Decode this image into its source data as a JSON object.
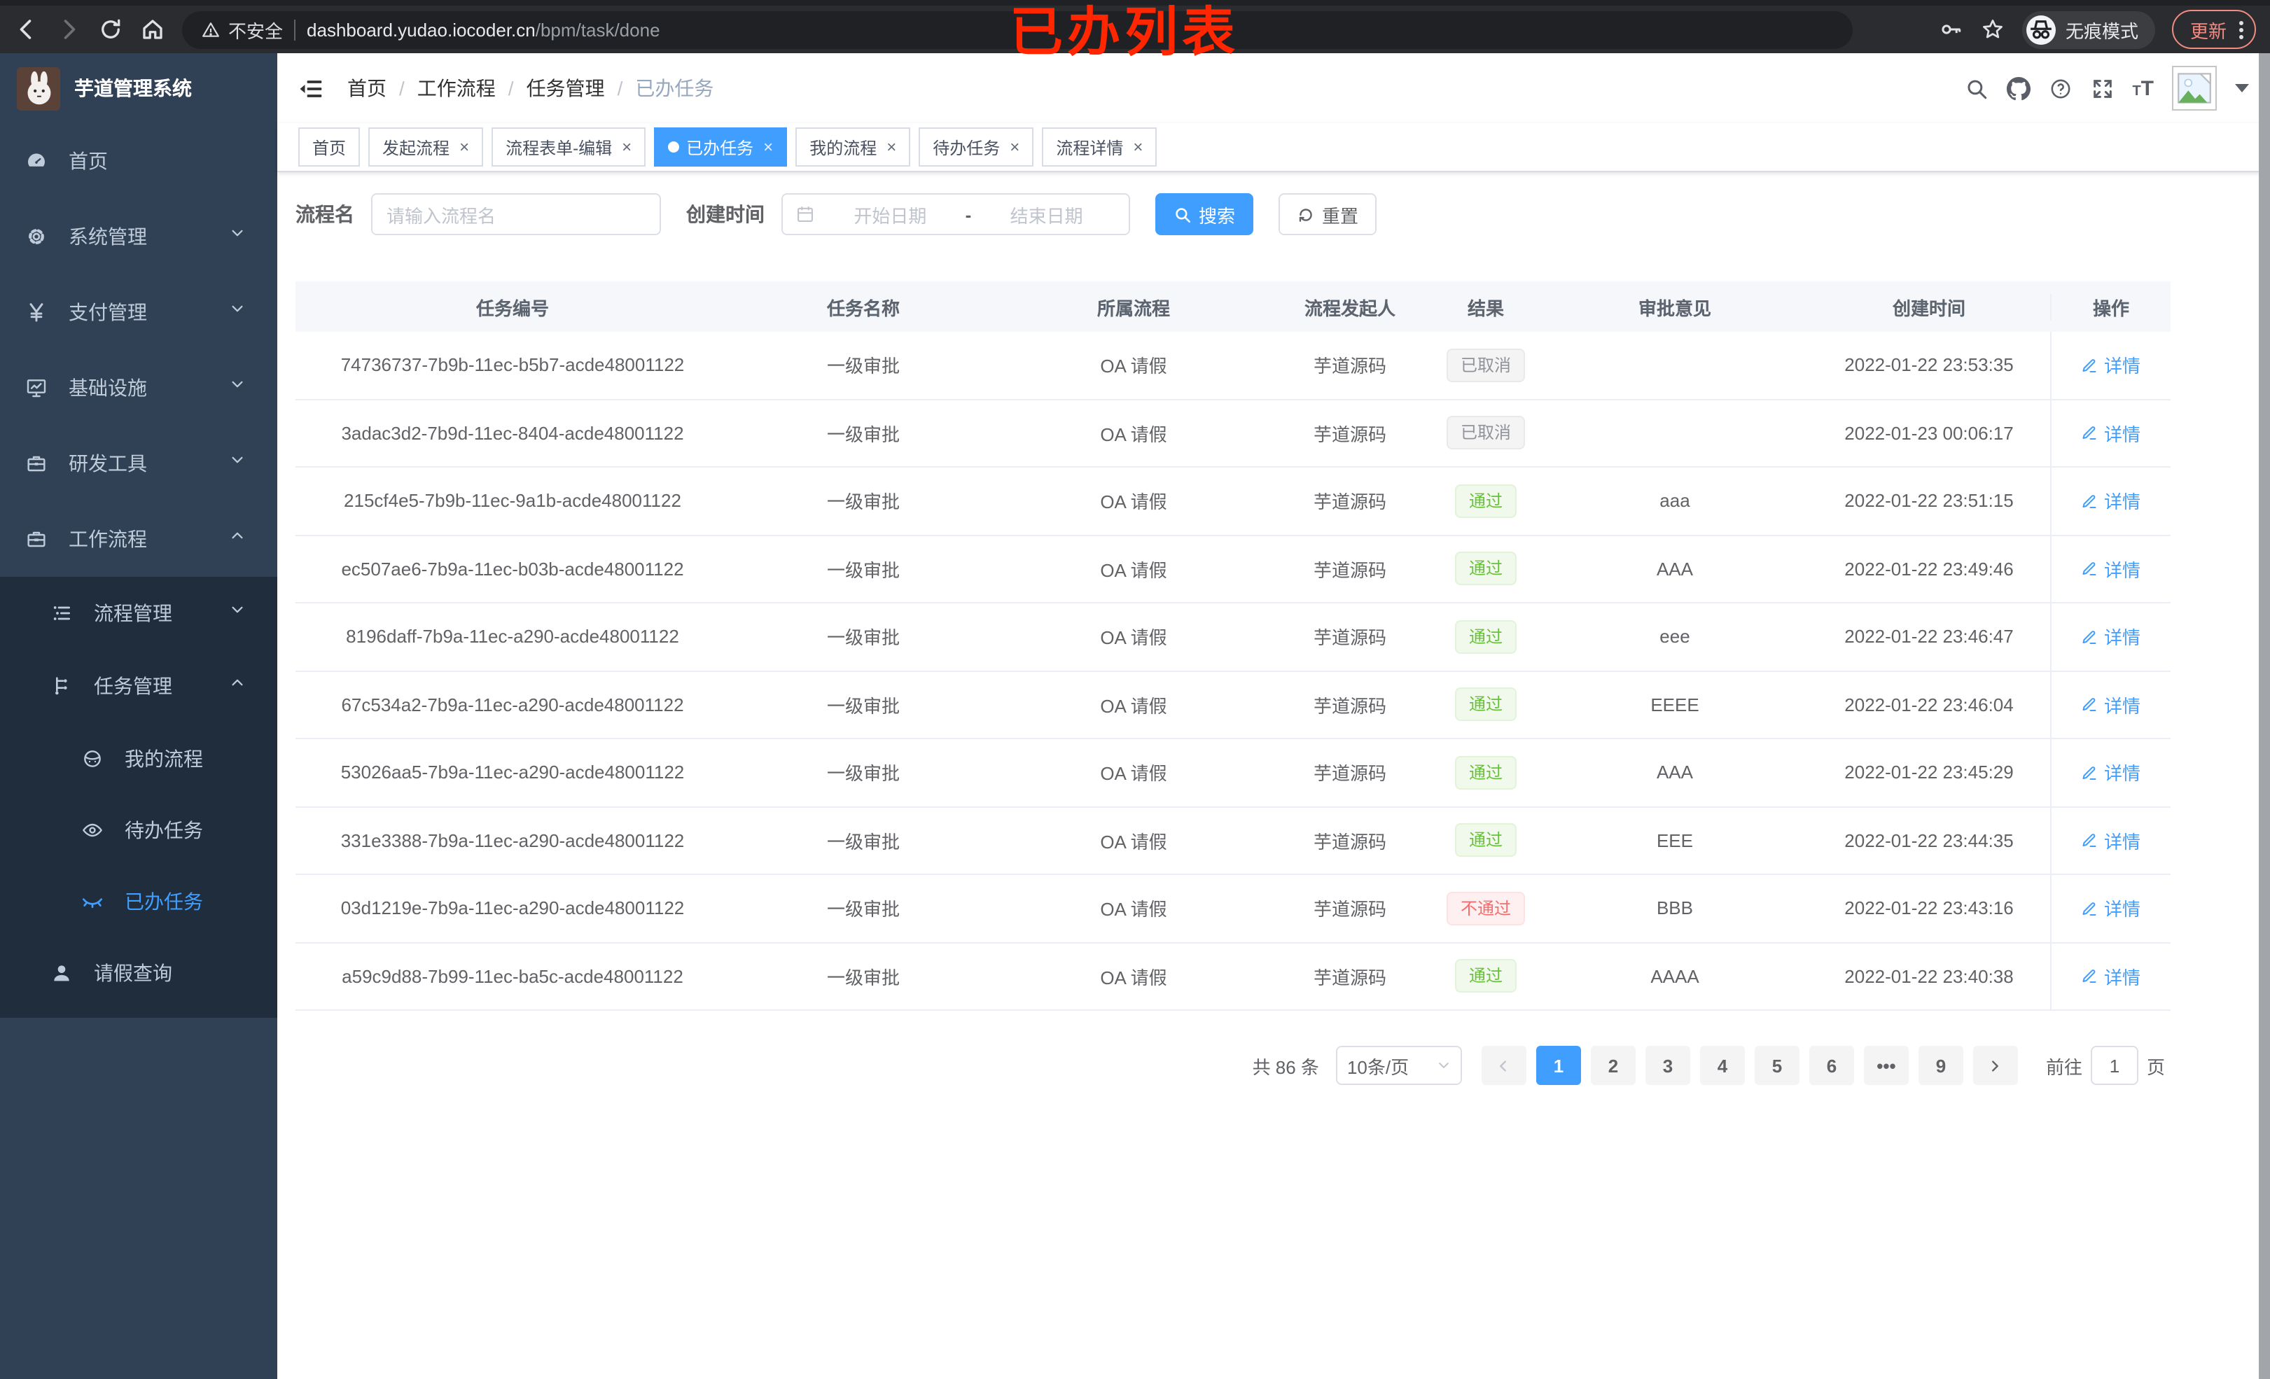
{
  "colors": {
    "accent": "#409eff",
    "sidebar_bg": "#304156",
    "submenu_bg": "#1f2d3d",
    "success": "#67c23a",
    "danger": "#f56c6c",
    "info": "#909399",
    "annotation": "#ff2600"
  },
  "overlay": {
    "title": "已办列表"
  },
  "browser": {
    "security_label": "不安全",
    "url_domain": "dashboard.yudao.iocoder.cn",
    "url_path": "/bpm/task/done",
    "incognito_label": "无痕模式",
    "update_label": "更新"
  },
  "sidebar": {
    "app_title": "芋道管理系统",
    "menu": [
      {
        "key": "home",
        "label": "首页",
        "icon": "dashboard"
      },
      {
        "key": "system",
        "label": "系统管理",
        "icon": "gear",
        "arrow": "down"
      },
      {
        "key": "payment",
        "label": "支付管理",
        "icon": "yen",
        "arrow": "down"
      },
      {
        "key": "infrastructure",
        "label": "基础设施",
        "icon": "monitor",
        "arrow": "down"
      },
      {
        "key": "devtools",
        "label": "研发工具",
        "icon": "toolbox",
        "arrow": "down"
      },
      {
        "key": "workflow",
        "label": "工作流程",
        "icon": "briefcase",
        "arrow": "up",
        "children": [
          {
            "key": "process-mgmt",
            "label": "流程管理",
            "icon": "flow-list",
            "arrow": "down"
          },
          {
            "key": "task-mgmt",
            "label": "任务管理",
            "icon": "task-tree",
            "arrow": "up",
            "children": [
              {
                "key": "my-process",
                "label": "我的流程",
                "icon": "robot"
              },
              {
                "key": "todo-tasks",
                "label": "待办任务",
                "icon": "eye-open"
              },
              {
                "key": "done-tasks",
                "label": "已办任务",
                "icon": "eye-closed",
                "active": true
              }
            ]
          },
          {
            "key": "leave-query",
            "label": "请假查询",
            "icon": "user"
          }
        ]
      }
    ]
  },
  "breadcrumb": [
    "首页",
    "工作流程",
    "任务管理",
    "已办任务"
  ],
  "tabs": [
    {
      "key": "home",
      "label": "首页",
      "closable": false,
      "active": false
    },
    {
      "key": "start-process",
      "label": "发起流程",
      "closable": true,
      "active": false
    },
    {
      "key": "form-edit",
      "label": "流程表单-编辑",
      "closable": true,
      "active": false
    },
    {
      "key": "done-tasks",
      "label": "已办任务",
      "closable": true,
      "active": true
    },
    {
      "key": "my-process",
      "label": "我的流程",
      "closable": true,
      "active": false
    },
    {
      "key": "todo-tasks",
      "label": "待办任务",
      "closable": true,
      "active": false
    },
    {
      "key": "process-detail",
      "label": "流程详情",
      "closable": true,
      "active": false
    }
  ],
  "filters": {
    "name_label": "流程名",
    "name_placeholder": "请输入流程名",
    "time_label": "创建时间",
    "start_placeholder": "开始日期",
    "range_separator": "-",
    "end_placeholder": "结束日期",
    "search_label": "搜索",
    "reset_label": "重置"
  },
  "table": {
    "columns": [
      "任务编号",
      "任务名称",
      "所属流程",
      "流程发起人",
      "结果",
      "审批意见",
      "创建时间",
      "操作"
    ],
    "action_label": "详情",
    "rows": [
      {
        "id": "74736737-7b9b-11ec-b5b7-acde48001122",
        "name": "一级审批",
        "process": "OA 请假",
        "starter": "芋道源码",
        "result": "已取消",
        "result_type": "info",
        "comment": "",
        "time": "2022-01-22 23:53:35"
      },
      {
        "id": "3adac3d2-7b9d-11ec-8404-acde48001122",
        "name": "一级审批",
        "process": "OA 请假",
        "starter": "芋道源码",
        "result": "已取消",
        "result_type": "info",
        "comment": "",
        "time": "2022-01-23 00:06:17"
      },
      {
        "id": "215cf4e5-7b9b-11ec-9a1b-acde48001122",
        "name": "一级审批",
        "process": "OA 请假",
        "starter": "芋道源码",
        "result": "通过",
        "result_type": "success",
        "comment": "aaa",
        "time": "2022-01-22 23:51:15"
      },
      {
        "id": "ec507ae6-7b9a-11ec-b03b-acde48001122",
        "name": "一级审批",
        "process": "OA 请假",
        "starter": "芋道源码",
        "result": "通过",
        "result_type": "success",
        "comment": "AAA",
        "time": "2022-01-22 23:49:46"
      },
      {
        "id": "8196daff-7b9a-11ec-a290-acde48001122",
        "name": "一级审批",
        "process": "OA 请假",
        "starter": "芋道源码",
        "result": "通过",
        "result_type": "success",
        "comment": "eee",
        "time": "2022-01-22 23:46:47"
      },
      {
        "id": "67c534a2-7b9a-11ec-a290-acde48001122",
        "name": "一级审批",
        "process": "OA 请假",
        "starter": "芋道源码",
        "result": "通过",
        "result_type": "success",
        "comment": "EEEE",
        "time": "2022-01-22 23:46:04"
      },
      {
        "id": "53026aa5-7b9a-11ec-a290-acde48001122",
        "name": "一级审批",
        "process": "OA 请假",
        "starter": "芋道源码",
        "result": "通过",
        "result_type": "success",
        "comment": "AAA",
        "time": "2022-01-22 23:45:29"
      },
      {
        "id": "331e3388-7b9a-11ec-a290-acde48001122",
        "name": "一级审批",
        "process": "OA 请假",
        "starter": "芋道源码",
        "result": "通过",
        "result_type": "success",
        "comment": "EEE",
        "time": "2022-01-22 23:44:35"
      },
      {
        "id": "03d1219e-7b9a-11ec-a290-acde48001122",
        "name": "一级审批",
        "process": "OA 请假",
        "starter": "芋道源码",
        "result": "不通过",
        "result_type": "danger",
        "comment": "BBB",
        "time": "2022-01-22 23:43:16"
      },
      {
        "id": "a59c9d88-7b99-11ec-ba5c-acde48001122",
        "name": "一级审批",
        "process": "OA 请假",
        "starter": "芋道源码",
        "result": "通过",
        "result_type": "success",
        "comment": "AAAA",
        "time": "2022-01-22 23:40:38"
      }
    ]
  },
  "pagination": {
    "total_text": "共 86 条",
    "page_size": "10条/页",
    "pages": [
      "1",
      "2",
      "3",
      "4",
      "5",
      "6",
      "•••",
      "9"
    ],
    "active_page": "1",
    "goto_label": "前往",
    "goto_value": "1",
    "goto_suffix": "页"
  }
}
